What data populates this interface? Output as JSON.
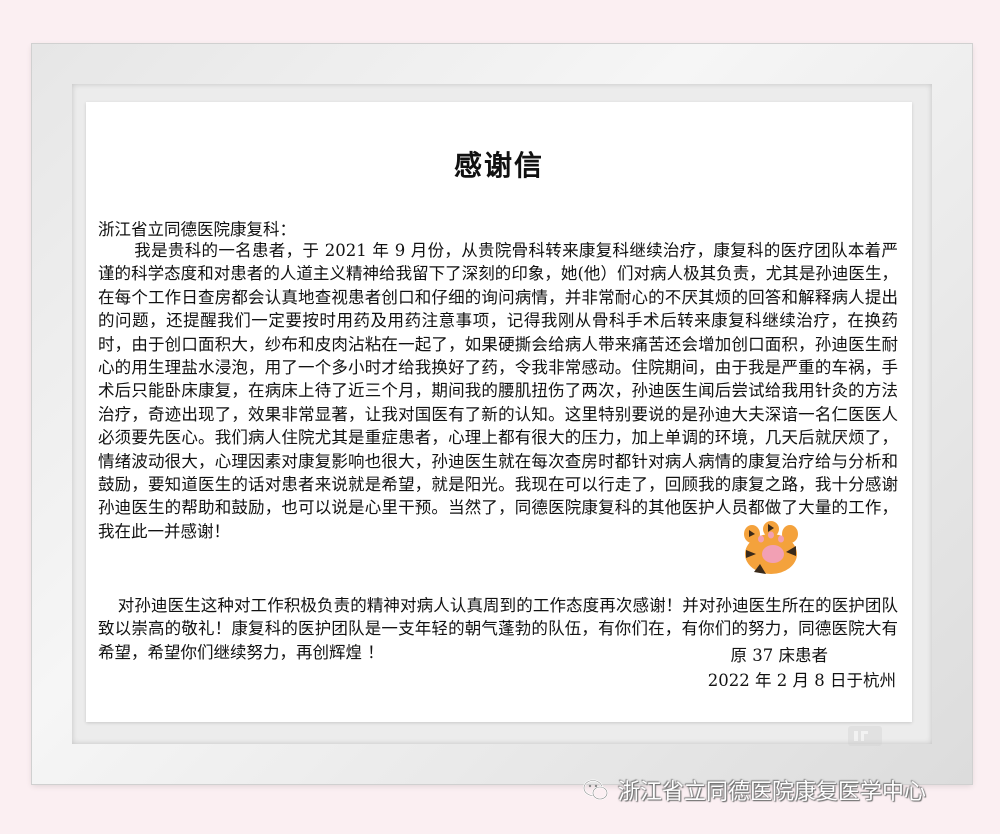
{
  "letter": {
    "title": "感谢信",
    "salutation": "浙江省立同德医院康复科：",
    "body": "我是贵科的一名患者，于 2021 年 9 月份，从贵院骨科转来康复科继续治疗，康复科的医疗团队本着严谨的科学态度和对患者的人道主义精神给我留下了深刻的印象，她(他）们对病人极其负责，尤其是孙迪医生，在每个工作日查房都会认真地查视患者创口和仔细的询问病情，并非常耐心的不厌其烦的回答和解释病人提出的问题，还提醒我们一定要按时用药及用药注意事项，记得我刚从骨科手术后转来康复科继续治疗，在换药时，由于创口面积大，纱布和皮肉沾粘在一起了，如果硬撕会给病人带来痛苦还会增加创口面积，孙迪医生耐心的用生理盐水浸泡，用了一个多小时才给我换好了药，令我非常感动。住院期间，由于我是严重的车祸，手术后只能卧床康复，在病床上待了近三个月，期间我的腰肌扭伤了两次，孙迪医生闻后尝试给我用针灸的方法治疗，奇迹出现了，效果非常显著，让我对国医有了新的认知。这里特别要说的是孙迪大夫深谙一名仁医医人必须要先医心。我们病人住院尤其是重症患者，心理上都有很大的压力，加上单调的环境，几天后就厌烦了，情绪波动很大，心理因素对康复影响也很大，孙迪医生就在每次查房时都针对病人病情的康复治疗给与分析和鼓励，要知道医生的话对患者来说就是希望，就是阳光。我现在可以行走了，回顾我的康复之路，我十分感谢孙迪医生的帮助和鼓励，也可以说是心里干预。当然了，同德医院康复科的其他医护人员都做了大量的工作，我在此一并感谢！",
    "closing": "对孙迪医生这种对工作积极负责的精神对病人认真周到的工作态度再次感谢！并对孙迪医生所在的医护团队致以崇高的敬礼！康复科的医护团队是一支年轻的朝气蓬勃的队伍，有你们在，有你们的努力，同德医院大有希望，希望你们继续努力，再创辉煌 ！",
    "signature": "原 37 床患者",
    "date": "2022 年 2 月 8 日于杭州"
  },
  "watermark": {
    "text": "浙江省立同德医院康复医学中心",
    "icon": "wechat-icon"
  },
  "colors": {
    "background": "#fbeff2",
    "frame": "#e6e6e6",
    "paper": "#ffffff",
    "text": "#111111",
    "paw_orange": "#f4a23c",
    "paw_dark": "#3a2a1a",
    "paw_pink": "#f2a0b4"
  },
  "icons": {
    "paw": "tiger-paw-icon",
    "logo": "faded-logo-icon"
  }
}
